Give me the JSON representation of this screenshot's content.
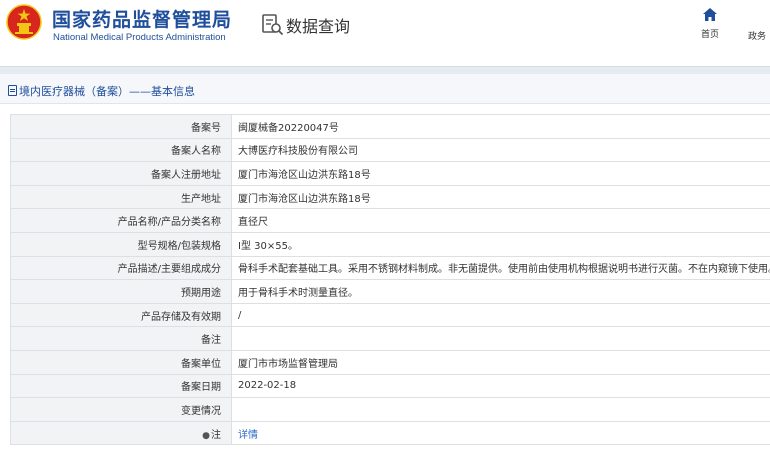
{
  "header": {
    "org_name_cn": "国家药品监督管理局",
    "org_name_en": "National Medical Products Administration",
    "section_title": "数据查询",
    "nav": [
      {
        "label": "首页"
      },
      {
        "label": "政务"
      }
    ]
  },
  "breadcrumb": {
    "text": "境内医疗器械（备案）——基本信息"
  },
  "record": {
    "rows": [
      {
        "label": "备案号",
        "value": "闽厦械备20220047号"
      },
      {
        "label": "备案人名称",
        "value": "大博医疗科技股份有限公司"
      },
      {
        "label": "备案人注册地址",
        "value": "厦门市海沧区山边洪东路18号"
      },
      {
        "label": "生产地址",
        "value": "厦门市海沧区山边洪东路18号"
      },
      {
        "label": "产品名称/产品分类名称",
        "value": "直径尺"
      },
      {
        "label": "型号规格/包装规格",
        "value": "Ⅰ型 30×55。"
      },
      {
        "label": "产品描述/主要组成成分",
        "value": "骨科手术配套基础工具。采用不锈钢材料制成。非无菌提供。使用前由使用机构根据说明书进行灭菌。不在内窥镜下使用。"
      },
      {
        "label": "预期用途",
        "value": "用于骨科手术时测量直径。"
      },
      {
        "label": "产品存储及有效期",
        "value": "/"
      },
      {
        "label": "备注",
        "value": ""
      },
      {
        "label": "备案单位",
        "value": "厦门市市场监督管理局"
      },
      {
        "label": "备案日期",
        "value": "2022-02-18"
      },
      {
        "label": "变更情况",
        "value": ""
      }
    ],
    "note_label": "注",
    "note_link": "详情"
  },
  "colors": {
    "brand_blue": "#1f4e9c",
    "emblem_red": "#d7261e",
    "emblem_gold": "#f3c613",
    "link_blue": "#2a6bc6"
  }
}
